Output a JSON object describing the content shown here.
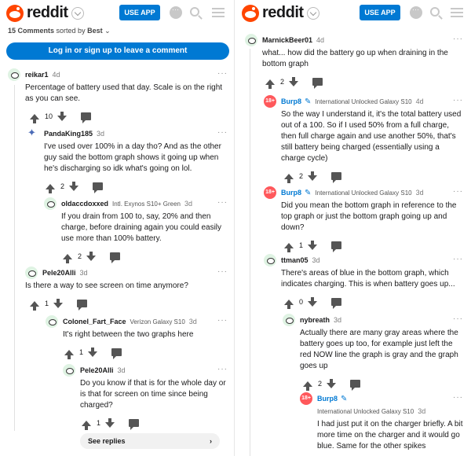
{
  "app": {
    "logo_text": "reddit",
    "use_app_label": "USE APP"
  },
  "sort": {
    "count_label": "15 Comments",
    "sorted_by_label": "sorted by",
    "sort_value": "Best",
    "chevron": "⌄"
  },
  "login_label": "Log in or sign up to leave a comment",
  "more_glyph": "···",
  "left_comments": [
    {
      "author": "reikar1",
      "time": "4d",
      "body": "Percentage of battery used that day. Scale is on the right as you can see.",
      "score": "10"
    },
    {
      "author": "PandaKing185",
      "time": "3d",
      "body": "I've used over 100% in a day tho? And as the other guy said the bottom graph shows it going up when he's discharging so idk what's going on lol.",
      "score": "2"
    },
    {
      "author": "oldaccdoxxed",
      "flair": "Intl. Exynos S10+ Green",
      "time": "3d",
      "body": "If you drain from 100 to, say, 20% and then charge, before draining again you could easily use more than 100% battery.",
      "score": "2"
    },
    {
      "author": "Pele20Alli",
      "time": "3d",
      "body": "Is there a way to see screen on time anymore?",
      "score": "1"
    },
    {
      "author": "Colonel_Fart_Face",
      "flair": "Verizon Galaxy S10",
      "time": "3d",
      "body": "It's right between the two graphs here",
      "score": "1"
    },
    {
      "author": "Pele20Alli",
      "time": "3d",
      "body": "Do you know if that is for the whole day or is that for screen on time since being charged?",
      "score": "1"
    }
  ],
  "see_replies_label": "See replies",
  "see_replies_chevron": "›",
  "right_comments": [
    {
      "author": "MarnickBeer01",
      "time": "4d",
      "body": "what... how did the battery go up when draining in the bottom graph",
      "score": "2"
    },
    {
      "author": "Burp8",
      "flair": "International Unlocked Galaxy S10",
      "time": "4d",
      "body": "So the way I understand it, it's the total battery used out of a 100. So if I used 50% from a full charge, then full charge again and use another 50%, that's still battery being charged (essentially using a charge cycle)",
      "score": "2"
    },
    {
      "author": "Burp8",
      "flair": "International Unlocked Galaxy S10",
      "time": "3d",
      "body": "Did you mean the bottom graph in reference to the top graph or just the bottom graph going up and down?",
      "score": "1"
    },
    {
      "author": "ttman05",
      "time": "3d",
      "body": "There's areas of blue in the bottom graph, which indicates charging. This is when battery goes up...",
      "score": "0"
    },
    {
      "author": "nybreath",
      "time": "3d",
      "body": "Actually there are many gray areas where the battery goes up too, for example just left the red NOW line the graph is gray and the graph goes up",
      "score": "2"
    },
    {
      "author": "Burp8",
      "flair": "International Unlocked Galaxy S10",
      "time": "3d",
      "body": "I had just put it on the charger briefly. A bit more time on the charger and it would go blue. Same for the other spikes"
    }
  ],
  "avatar_badge_18": "18+",
  "colors": {
    "accent": "#0079d3",
    "brand": "#ff4500",
    "nsfw": "#ff585b"
  }
}
